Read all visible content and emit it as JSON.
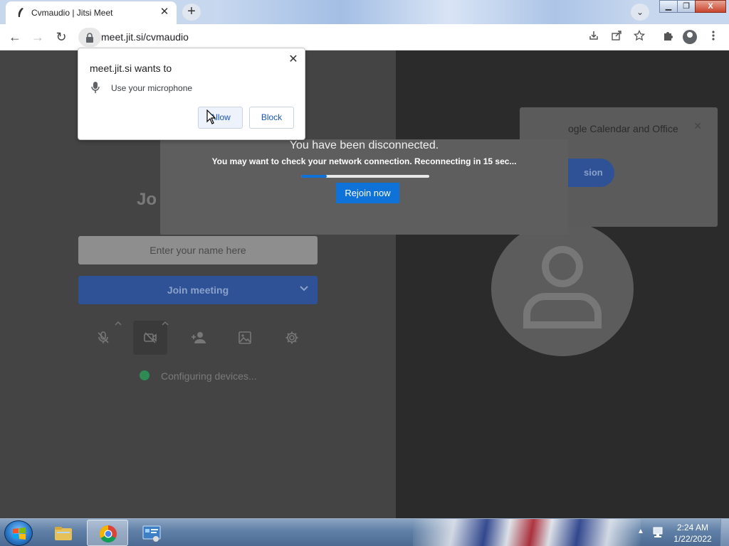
{
  "browser": {
    "tab_title": "Cvmaudio | Jitsi Meet",
    "tab_close": "✕",
    "new_tab": "+",
    "tab_search": "⌄",
    "url": "meet.jit.si/cvmaudio",
    "window_controls": {
      "minimize": "▁",
      "maximize": "❐",
      "close": "X"
    },
    "nav": {
      "back": "←",
      "forward": "→",
      "reload": "↻"
    }
  },
  "permission_popup": {
    "heading": "meet.jit.si wants to",
    "request": "Use your microphone",
    "allow_label": "Allow",
    "block_label": "Block",
    "close": "✕"
  },
  "disconnect_dialog": {
    "title": "You have been disconnected.",
    "message": "You may want to check your network connection. Reconnecting in 15 sec...",
    "progress": 0.2,
    "rejoin_label": "Rejoin now"
  },
  "prejoin": {
    "title_visible": "Jo",
    "name_placeholder": "Enter your name here",
    "join_label": "Join meeting",
    "status_text": "Configuring devices..."
  },
  "calendar_banner": {
    "text": "ogle Calendar and Office",
    "button_label": "sion",
    "close": "✕"
  },
  "taskbar": {
    "time": "2:24 AM",
    "date": "1/22/2022",
    "tray_arrow": "▲"
  },
  "colors": {
    "accent_blue": "#0e72d9",
    "join_blue": "#2f5196",
    "status_green": "#2d8b54"
  }
}
